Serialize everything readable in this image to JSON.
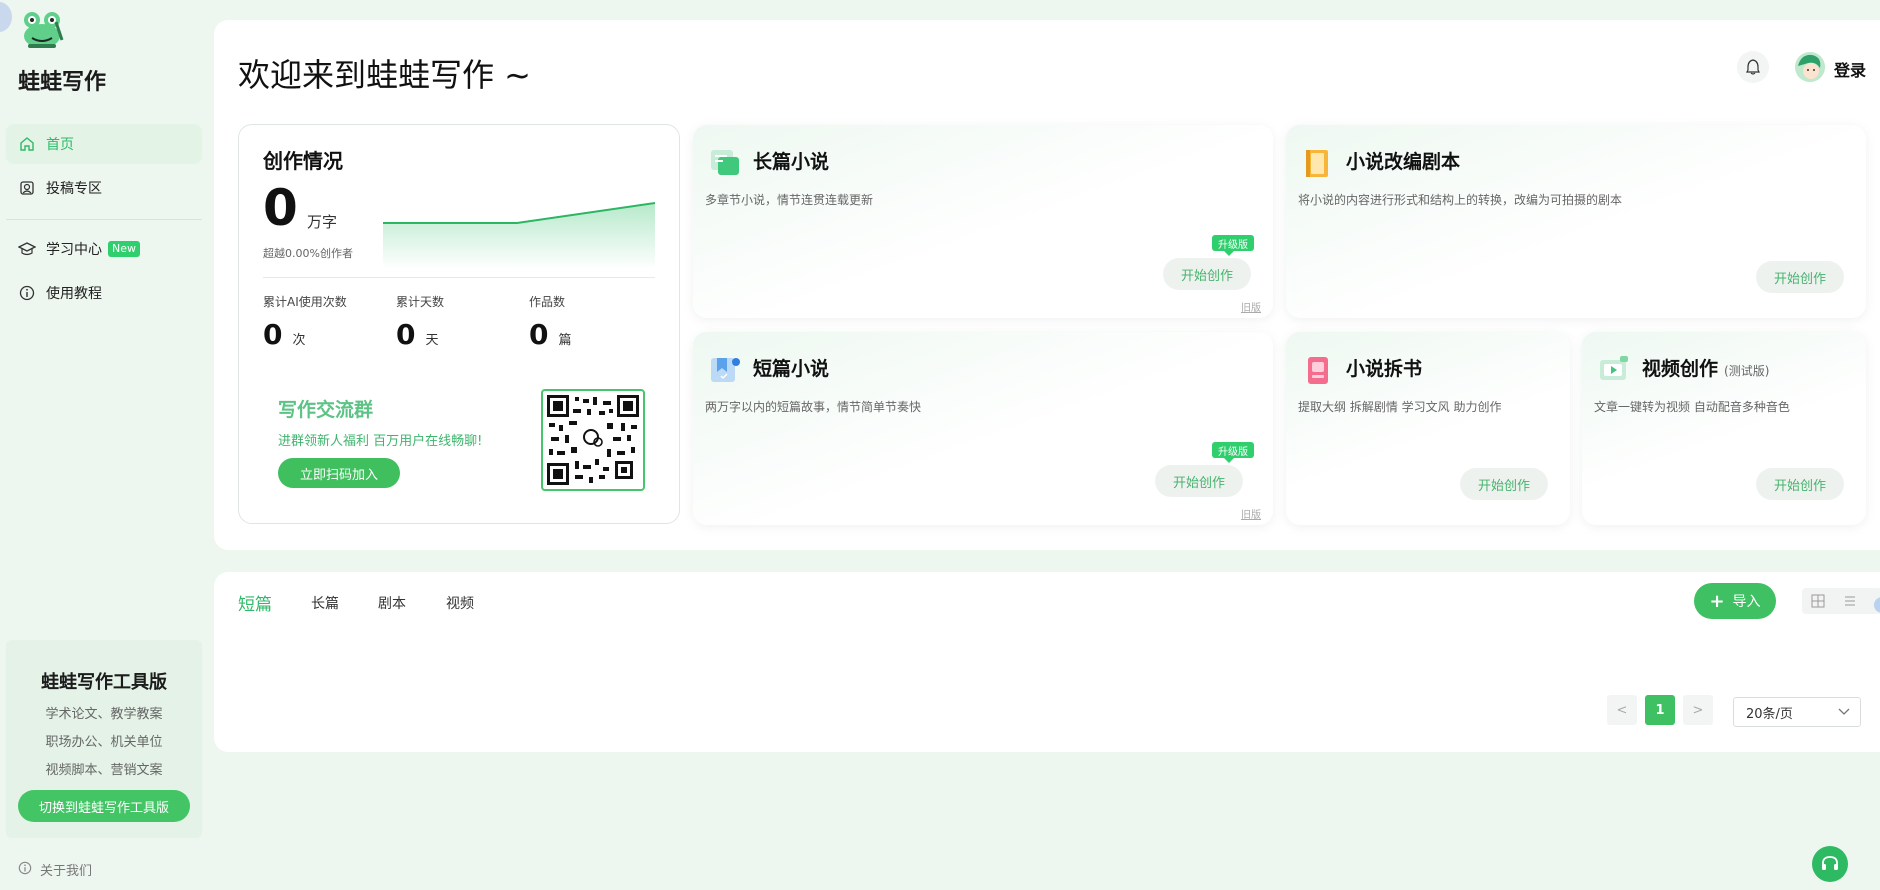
{
  "app": {
    "name": "蛙蛙写作"
  },
  "sidebar": {
    "items": [
      {
        "label": "首页",
        "icon": "home-icon",
        "active": true
      },
      {
        "label": "投稿专区",
        "icon": "submit-icon"
      },
      {
        "label": "学习中心",
        "icon": "graduation-cap-icon",
        "badge": "New"
      },
      {
        "label": "使用教程",
        "icon": "info-icon"
      }
    ],
    "tool_card": {
      "title": "蛙蛙写作工具版",
      "lines": [
        "学术论文、教学教案",
        "职场办公、机关单位",
        "视频脚本、营销文案"
      ],
      "button": "切换到蛙蛙写作工具版"
    },
    "about": "关于我们"
  },
  "header": {
    "welcome": "欢迎来到蛙蛙写作 ~",
    "login": "登录"
  },
  "stats": {
    "title": "创作情况",
    "words_value": "0",
    "words_unit": "万字",
    "exceed_text": "超越0.00%创作者",
    "metrics": [
      {
        "label": "累计AI使用次数",
        "value": "0",
        "unit": "次"
      },
      {
        "label": "累计天数",
        "value": "0",
        "unit": "天"
      },
      {
        "label": "作品数",
        "value": "0",
        "unit": "篇"
      }
    ],
    "group": {
      "title": "写作交流群",
      "desc": "进群领新人福利 百万用户在线畅聊!",
      "button": "立即扫码加入"
    }
  },
  "features": {
    "long_novel": {
      "title": "长篇小说",
      "desc": "多章节小说，情节连贯连载更新",
      "button": "开始创作",
      "tag": "升级版",
      "old": "旧版"
    },
    "adapt_script": {
      "title": "小说改编剧本",
      "desc": "将小说的内容进行形式和结构上的转换，改编为可拍摄的剧本",
      "button": "开始创作"
    },
    "short_novel": {
      "title": "短篇小说",
      "desc": "两万字以内的短篇故事，情节简单节奏快",
      "button": "开始创作",
      "tag": "升级版",
      "old": "旧版"
    },
    "book_split": {
      "title": "小说拆书",
      "desc": "提取大纲 拆解剧情 学习文风 助力创作",
      "button": "开始创作"
    },
    "video": {
      "title": "视频创作",
      "tag": "(测试版)",
      "desc": "文章一键转为视频 自动配音多种音色",
      "button": "开始创作"
    }
  },
  "works": {
    "tabs": [
      "短篇",
      "长篇",
      "剧本",
      "视频"
    ],
    "active_tab": "短篇",
    "import_button": "导入",
    "pagination": {
      "prev": "<",
      "current": "1",
      "next": ">",
      "page_size": "20条/页"
    }
  },
  "colors": {
    "accent": "#3fc062",
    "accent_text": "#2fb969",
    "background": "#edf6ef"
  }
}
